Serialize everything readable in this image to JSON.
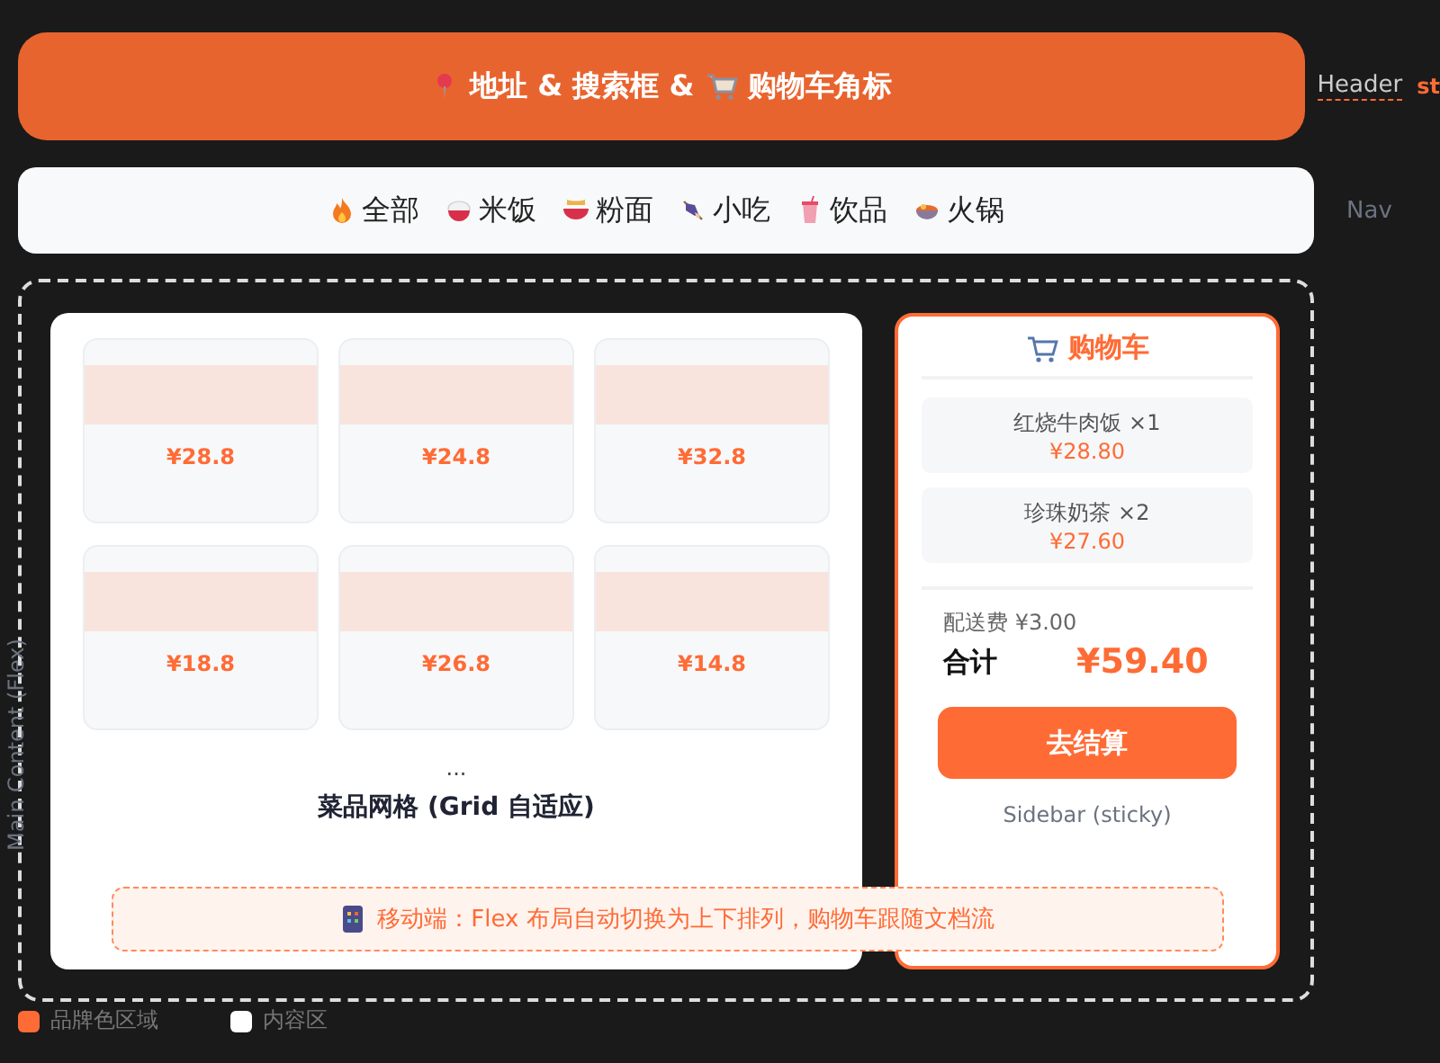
{
  "header": {
    "title": "地址 & 搜索框 &",
    "title_2": "购物车角标",
    "label": "Header",
    "cut_label": "st"
  },
  "nav": {
    "label": "Nav",
    "categories": [
      {
        "label": "全部"
      },
      {
        "label": "米饭"
      },
      {
        "label": "粉面"
      },
      {
        "label": "小吃"
      },
      {
        "label": "饮品"
      },
      {
        "label": "火锅"
      }
    ]
  },
  "main": {
    "label": "Main Content (Flex)",
    "dishes": [
      {
        "price": "¥28.8"
      },
      {
        "price": "¥24.8"
      },
      {
        "price": "¥32.8"
      },
      {
        "price": "¥18.8"
      },
      {
        "price": "¥26.8"
      },
      {
        "price": "¥14.8"
      }
    ],
    "ellipsis": "...",
    "grid_caption": "菜品网格 (Grid 自适应)"
  },
  "cart": {
    "title": "购物车",
    "items": [
      {
        "name": "红烧牛肉饭 ×1",
        "price": "¥28.80"
      },
      {
        "name": "珍珠奶茶 ×2",
        "price": "¥27.60"
      }
    ],
    "delivery": "配送费 ¥3.00",
    "total_label": "合计",
    "total": "¥59.40",
    "checkout": "去结算",
    "caption": "Sidebar (sticky)"
  },
  "mobile_note": "移动端：Flex 布局自动切换为上下排列，购物车跟随文档流",
  "legend": [
    {
      "label": "品牌色区域",
      "color": "#ff6b35"
    },
    {
      "label": "内容区",
      "color": "#ffffff"
    }
  ]
}
